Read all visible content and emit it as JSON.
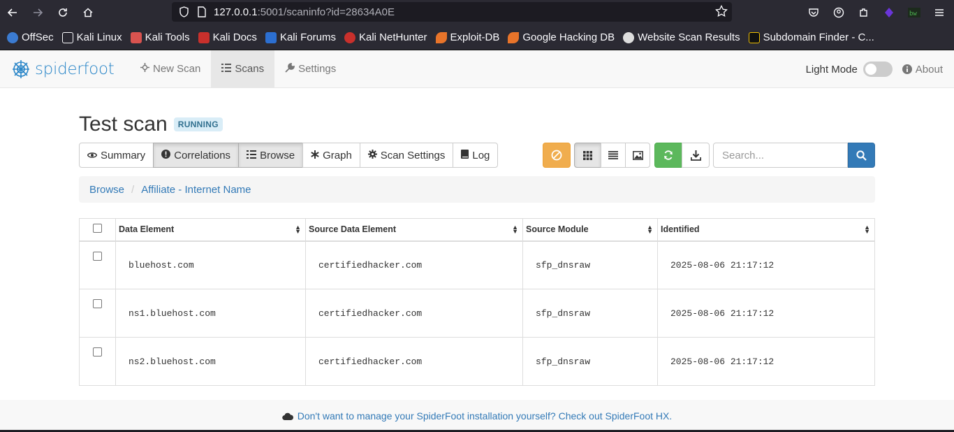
{
  "browser": {
    "url_host": "127.0.0.1",
    "url_rest": ":5001/scaninfo?id=28634A0E",
    "bookmarks": [
      {
        "label": "OffSec",
        "color": "#3b7bd1"
      },
      {
        "label": "Kali Linux",
        "color": "#2b2a33"
      },
      {
        "label": "Kali Tools",
        "color": "#d9534f"
      },
      {
        "label": "Kali Docs",
        "color": "#c9302c"
      },
      {
        "label": "Kali Forums",
        "color": "#2c6fd1"
      },
      {
        "label": "Kali NetHunter",
        "color": "#c9302c"
      },
      {
        "label": "Exploit-DB",
        "color": "#e8742a"
      },
      {
        "label": "Google Hacking DB",
        "color": "#e8742a"
      },
      {
        "label": "Website Scan Results",
        "color": "#dddddd"
      },
      {
        "label": "Subdomain Finder - C...",
        "color": "#111111"
      }
    ]
  },
  "navbar": {
    "brand": "spiderfoot",
    "items": [
      {
        "label": "New Scan",
        "icon": "crosshair-icon"
      },
      {
        "label": "Scans",
        "icon": "list-icon"
      },
      {
        "label": "Settings",
        "icon": "wrench-icon"
      }
    ],
    "light_mode_label": "Light Mode",
    "about_label": "About"
  },
  "scan": {
    "title": "Test scan",
    "status": "RUNNING"
  },
  "tabs": [
    {
      "label": "Summary",
      "icon": "eye-icon"
    },
    {
      "label": "Correlations",
      "icon": "exclamation-icon"
    },
    {
      "label": "Browse",
      "icon": "list-icon"
    },
    {
      "label": "Graph",
      "icon": "asterisk-icon"
    },
    {
      "label": "Scan Settings",
      "icon": "cog-icon"
    },
    {
      "label": "Log",
      "icon": "book-icon"
    }
  ],
  "search": {
    "placeholder": "Search..."
  },
  "breadcrumb": [
    "Browse",
    "Affiliate - Internet Name"
  ],
  "table": {
    "headers": [
      "Data Element",
      "Source Data Element",
      "Source Module",
      "Identified"
    ],
    "rows": [
      [
        "bluehost.com",
        "certifiedhacker.com",
        "sfp_dnsraw",
        "2025-08-06 21:17:12"
      ],
      [
        "ns1.bluehost.com",
        "certifiedhacker.com",
        "sfp_dnsraw",
        "2025-08-06 21:17:12"
      ],
      [
        "ns2.bluehost.com",
        "certifiedhacker.com",
        "sfp_dnsraw",
        "2025-08-06 21:17:12"
      ]
    ]
  },
  "footer": {
    "text": "Don't want to manage your SpiderFoot installation yourself? Check out SpiderFoot HX."
  }
}
